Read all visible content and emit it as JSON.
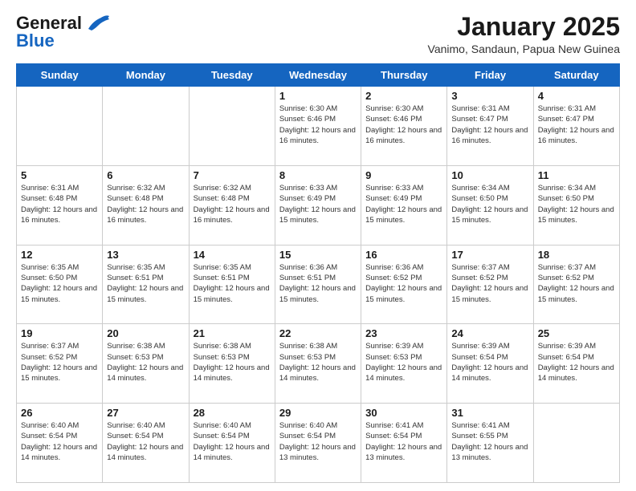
{
  "header": {
    "logo_line1": "General",
    "logo_line2": "Blue",
    "month_title": "January 2025",
    "location": "Vanimo, Sandaun, Papua New Guinea"
  },
  "weekdays": [
    "Sunday",
    "Monday",
    "Tuesday",
    "Wednesday",
    "Thursday",
    "Friday",
    "Saturday"
  ],
  "weeks": [
    [
      {
        "day": "",
        "info": ""
      },
      {
        "day": "",
        "info": ""
      },
      {
        "day": "",
        "info": ""
      },
      {
        "day": "1",
        "info": "Sunrise: 6:30 AM\nSunset: 6:46 PM\nDaylight: 12 hours and 16 minutes."
      },
      {
        "day": "2",
        "info": "Sunrise: 6:30 AM\nSunset: 6:46 PM\nDaylight: 12 hours and 16 minutes."
      },
      {
        "day": "3",
        "info": "Sunrise: 6:31 AM\nSunset: 6:47 PM\nDaylight: 12 hours and 16 minutes."
      },
      {
        "day": "4",
        "info": "Sunrise: 6:31 AM\nSunset: 6:47 PM\nDaylight: 12 hours and 16 minutes."
      }
    ],
    [
      {
        "day": "5",
        "info": "Sunrise: 6:31 AM\nSunset: 6:48 PM\nDaylight: 12 hours and 16 minutes."
      },
      {
        "day": "6",
        "info": "Sunrise: 6:32 AM\nSunset: 6:48 PM\nDaylight: 12 hours and 16 minutes."
      },
      {
        "day": "7",
        "info": "Sunrise: 6:32 AM\nSunset: 6:48 PM\nDaylight: 12 hours and 16 minutes."
      },
      {
        "day": "8",
        "info": "Sunrise: 6:33 AM\nSunset: 6:49 PM\nDaylight: 12 hours and 15 minutes."
      },
      {
        "day": "9",
        "info": "Sunrise: 6:33 AM\nSunset: 6:49 PM\nDaylight: 12 hours and 15 minutes."
      },
      {
        "day": "10",
        "info": "Sunrise: 6:34 AM\nSunset: 6:50 PM\nDaylight: 12 hours and 15 minutes."
      },
      {
        "day": "11",
        "info": "Sunrise: 6:34 AM\nSunset: 6:50 PM\nDaylight: 12 hours and 15 minutes."
      }
    ],
    [
      {
        "day": "12",
        "info": "Sunrise: 6:35 AM\nSunset: 6:50 PM\nDaylight: 12 hours and 15 minutes."
      },
      {
        "day": "13",
        "info": "Sunrise: 6:35 AM\nSunset: 6:51 PM\nDaylight: 12 hours and 15 minutes."
      },
      {
        "day": "14",
        "info": "Sunrise: 6:35 AM\nSunset: 6:51 PM\nDaylight: 12 hours and 15 minutes."
      },
      {
        "day": "15",
        "info": "Sunrise: 6:36 AM\nSunset: 6:51 PM\nDaylight: 12 hours and 15 minutes."
      },
      {
        "day": "16",
        "info": "Sunrise: 6:36 AM\nSunset: 6:52 PM\nDaylight: 12 hours and 15 minutes."
      },
      {
        "day": "17",
        "info": "Sunrise: 6:37 AM\nSunset: 6:52 PM\nDaylight: 12 hours and 15 minutes."
      },
      {
        "day": "18",
        "info": "Sunrise: 6:37 AM\nSunset: 6:52 PM\nDaylight: 12 hours and 15 minutes."
      }
    ],
    [
      {
        "day": "19",
        "info": "Sunrise: 6:37 AM\nSunset: 6:52 PM\nDaylight: 12 hours and 15 minutes."
      },
      {
        "day": "20",
        "info": "Sunrise: 6:38 AM\nSunset: 6:53 PM\nDaylight: 12 hours and 14 minutes."
      },
      {
        "day": "21",
        "info": "Sunrise: 6:38 AM\nSunset: 6:53 PM\nDaylight: 12 hours and 14 minutes."
      },
      {
        "day": "22",
        "info": "Sunrise: 6:38 AM\nSunset: 6:53 PM\nDaylight: 12 hours and 14 minutes."
      },
      {
        "day": "23",
        "info": "Sunrise: 6:39 AM\nSunset: 6:53 PM\nDaylight: 12 hours and 14 minutes."
      },
      {
        "day": "24",
        "info": "Sunrise: 6:39 AM\nSunset: 6:54 PM\nDaylight: 12 hours and 14 minutes."
      },
      {
        "day": "25",
        "info": "Sunrise: 6:39 AM\nSunset: 6:54 PM\nDaylight: 12 hours and 14 minutes."
      }
    ],
    [
      {
        "day": "26",
        "info": "Sunrise: 6:40 AM\nSunset: 6:54 PM\nDaylight: 12 hours and 14 minutes."
      },
      {
        "day": "27",
        "info": "Sunrise: 6:40 AM\nSunset: 6:54 PM\nDaylight: 12 hours and 14 minutes."
      },
      {
        "day": "28",
        "info": "Sunrise: 6:40 AM\nSunset: 6:54 PM\nDaylight: 12 hours and 14 minutes."
      },
      {
        "day": "29",
        "info": "Sunrise: 6:40 AM\nSunset: 6:54 PM\nDaylight: 12 hours and 13 minutes."
      },
      {
        "day": "30",
        "info": "Sunrise: 6:41 AM\nSunset: 6:54 PM\nDaylight: 12 hours and 13 minutes."
      },
      {
        "day": "31",
        "info": "Sunrise: 6:41 AM\nSunset: 6:55 PM\nDaylight: 12 hours and 13 minutes."
      },
      {
        "day": "",
        "info": ""
      }
    ]
  ]
}
